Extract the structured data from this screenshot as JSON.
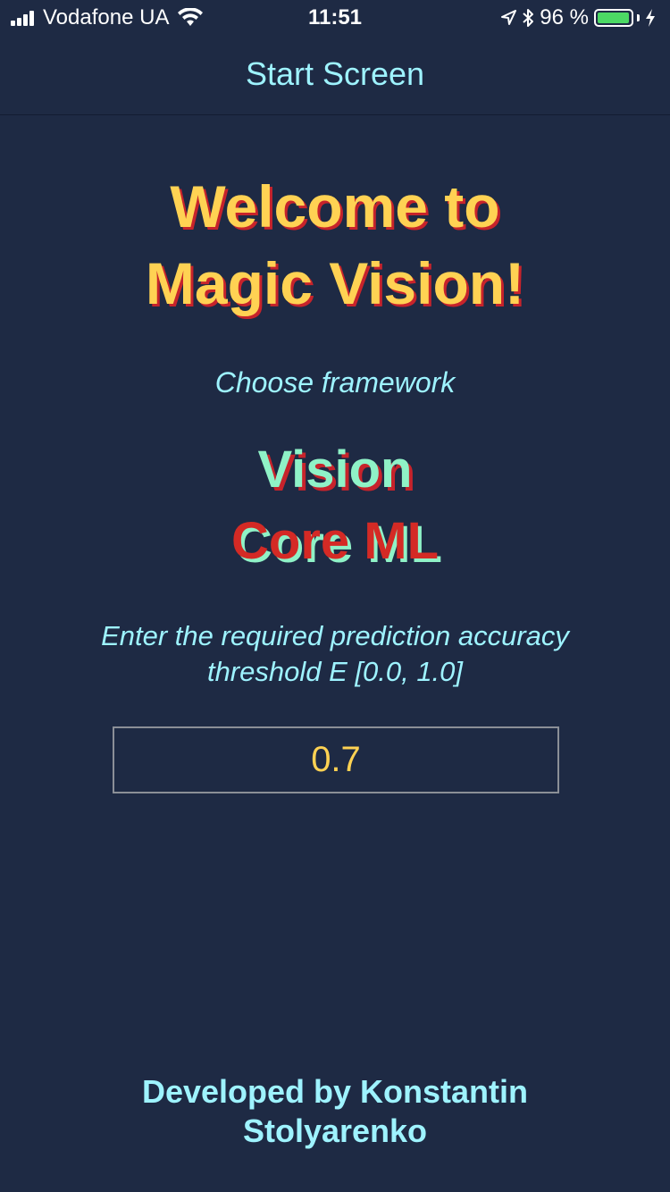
{
  "status_bar": {
    "carrier": "Vodafone UA",
    "time": "11:51",
    "battery_percent": "96 %",
    "battery_level": 0.96,
    "icons": [
      "signal-bars-icon",
      "wifi-icon",
      "location-arrow-icon",
      "bluetooth-icon",
      "battery-icon",
      "charging-bolt-icon"
    ]
  },
  "nav": {
    "title": "Start Screen"
  },
  "main": {
    "welcome_line1": "Welcome to",
    "welcome_line2": "Magic Vision!",
    "choose_label": "Choose framework",
    "frameworks": [
      {
        "label": "Vision"
      },
      {
        "label": "Core ML"
      }
    ],
    "threshold_line1": "Enter the required prediction accuracy",
    "threshold_line2": "threshold E [0.0, 1.0]",
    "threshold_value": "0.7"
  },
  "footer": {
    "line1": "Developed by Konstantin",
    "line2": "Stolyarenko"
  },
  "colors": {
    "background": "#1e2a44",
    "accent_cyan": "#9ef3ff",
    "accent_yellow": "#ffd253",
    "accent_red": "#c7232b",
    "accent_mint": "#8ff2c7"
  }
}
